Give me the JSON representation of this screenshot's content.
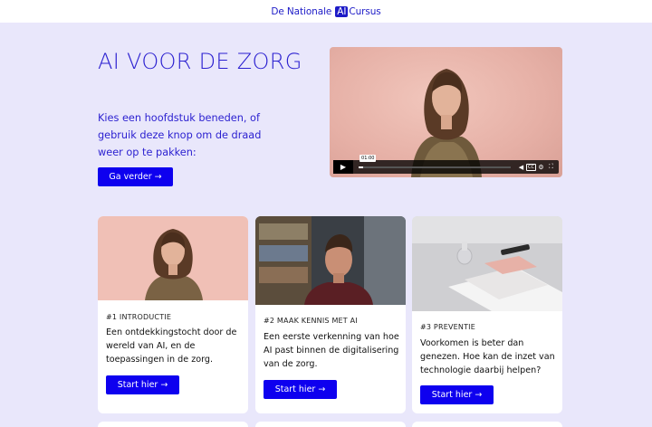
{
  "brand": {
    "prefix": "De Nationale",
    "ai": "AI",
    "suffix": "Cursus"
  },
  "hero": {
    "title": "AI VOOR DE ZORG",
    "text": "Kies een hoofdstuk beneden, of gebruik deze knop om de draad weer op te pakken:",
    "button": "Ga verder →"
  },
  "video": {
    "time": "01:00",
    "progress": 0.03,
    "icons": [
      "play-icon",
      "volume-icon",
      "captions-icon",
      "settings-icon",
      "fullscreen-icon"
    ],
    "cc": "CC"
  },
  "cards": [
    {
      "kicker": "#1 INTRODUCTIE",
      "desc": "Een ontdekkingstocht door de wereld van AI, en de toepassingen in de zorg.",
      "button": "Start hier →"
    },
    {
      "kicker": "#2 MAAK KENNIS MET AI",
      "desc": "Een eerste verkenning van hoe AI past binnen de digitalisering van de zorg.",
      "button": "Start hier →"
    },
    {
      "kicker": "#3 PREVENTIE",
      "desc": "Voorkomen is beter dan genezen. Hoe kan de inzet van technologie daarbij helpen?",
      "button": "Start hier →"
    }
  ],
  "colors": {
    "accent": "#0e00ef",
    "heading": "#2a1fd0",
    "page_bg": "#e9e7fb"
  }
}
